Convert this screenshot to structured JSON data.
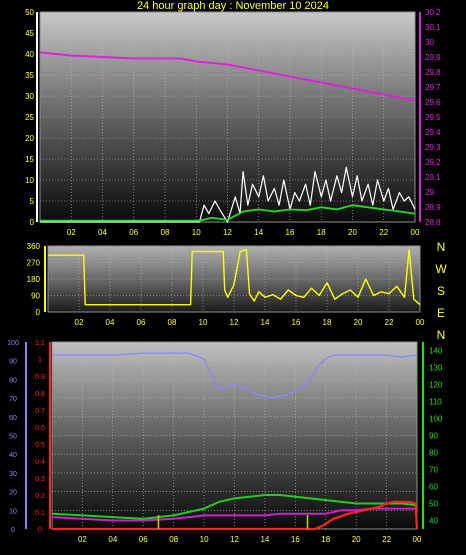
{
  "title": "24 hour graph day : November 10 2024",
  "colors": {
    "wind": "#ffffff",
    "gust": "#ffffff",
    "avg": "#22dd22",
    "pressure": "#dd22dd",
    "dir": "#ffff00",
    "humidity": "#8888ff",
    "temp": "#22cc22",
    "rain": "#ff2222",
    "dew": "#cc22cc",
    "solar": "#cccc00"
  },
  "compass": [
    "N",
    "W",
    "S",
    "E",
    "N"
  ],
  "chart_data": [
    {
      "type": "line",
      "name": "wind-pressure",
      "x_ticks": [
        "02",
        "04",
        "06",
        "08",
        "10",
        "12",
        "14",
        "16",
        "18",
        "20",
        "22",
        "00"
      ],
      "y_left_ticks": [
        "0",
        "5",
        "10",
        "15",
        "20",
        "25",
        "30",
        "35",
        "40",
        "45",
        "50"
      ],
      "y_left_lim": [
        0,
        50
      ],
      "y_right_ticks": [
        "28.8",
        "28.9",
        "29",
        "29.1",
        "29.2",
        "29.3",
        "29.4",
        "29.5",
        "29.6",
        "29.7",
        "29.8",
        "29.9",
        "30",
        "30.1",
        "30.2"
      ],
      "y_right_lim": [
        28.8,
        30.2
      ],
      "series": [
        {
          "axis": "right",
          "color": "pressure",
          "x": [
            0,
            2,
            4,
            6,
            8,
            9,
            10,
            11,
            12,
            13,
            14,
            15,
            16,
            17,
            18,
            19,
            20,
            21,
            22,
            23,
            24
          ],
          "y": [
            29.93,
            29.91,
            29.9,
            29.89,
            29.89,
            29.89,
            29.87,
            29.86,
            29.85,
            29.83,
            29.81,
            29.79,
            29.77,
            29.75,
            29.73,
            29.71,
            29.69,
            29.67,
            29.65,
            29.63,
            29.61
          ]
        },
        {
          "axis": "left",
          "color": "gust",
          "x": [
            0,
            10.2,
            10.5,
            10.8,
            11.2,
            11.5,
            12.0,
            12.5,
            12.8,
            13.0,
            13.3,
            13.6,
            14.0,
            14.3,
            14.6,
            15.0,
            15.3,
            15.6,
            16.0,
            16.3,
            16.6,
            17.0,
            17.3,
            17.6,
            18.0,
            18.3,
            18.6,
            19.0,
            19.3,
            19.6,
            20.0,
            20.3,
            20.6,
            21.0,
            21.3,
            21.6,
            22.0,
            22.3,
            22.6,
            23.0,
            23.3,
            23.6,
            24.0
          ],
          "y": [
            0,
            0,
            4,
            2,
            5,
            3,
            0,
            6,
            2,
            12,
            4,
            9,
            6,
            11,
            5,
            8,
            4,
            10,
            3,
            7,
            5,
            9,
            4,
            12,
            6,
            10,
            5,
            11,
            7,
            13,
            6,
            11,
            5,
            9,
            4,
            10,
            5,
            8,
            3,
            7,
            5,
            6,
            3
          ]
        },
        {
          "axis": "left",
          "color": "avg",
          "x": [
            0,
            10.2,
            11.0,
            12.0,
            12.5,
            13.0,
            14.0,
            15.0,
            16.0,
            17.0,
            18.0,
            19.0,
            20.0,
            21.0,
            22.0,
            23.0,
            24.0
          ],
          "y": [
            0.3,
            0.3,
            1,
            0.5,
            1.5,
            2.5,
            3,
            2.5,
            3,
            2.8,
            3.5,
            3,
            4,
            3.5,
            3,
            2.5,
            2
          ]
        }
      ]
    },
    {
      "type": "line",
      "name": "wind-direction",
      "x_ticks": [
        "02",
        "04",
        "06",
        "08",
        "10",
        "12",
        "14",
        "16",
        "18",
        "20",
        "22",
        "00"
      ],
      "y_ticks": [
        "0",
        "90",
        "180",
        "270",
        "360"
      ],
      "ylim": [
        0,
        360
      ],
      "series": [
        {
          "color": "dir",
          "x": [
            0,
            0.3,
            2.3,
            2.4,
            9.2,
            9.3,
            11.3,
            11.4,
            11.6,
            12.0,
            12.4,
            12.8,
            13.0,
            13.3,
            13.6,
            14.0,
            14.5,
            15.0,
            15.5,
            16.0,
            16.5,
            17.0,
            17.5,
            18.0,
            18.5,
            19.0,
            19.5,
            20.0,
            20.5,
            21.0,
            21.5,
            22.0,
            22.5,
            23.0,
            23.3,
            23.6,
            24.0
          ],
          "y": [
            310,
            310,
            310,
            40,
            40,
            330,
            330,
            120,
            80,
            150,
            330,
            340,
            100,
            60,
            110,
            80,
            95,
            70,
            120,
            90,
            80,
            130,
            90,
            160,
            70,
            100,
            120,
            80,
            180,
            90,
            110,
            100,
            140,
            80,
            340,
            70,
            40
          ]
        }
      ]
    },
    {
      "type": "line",
      "name": "humidity-temp-rain",
      "x_ticks": [
        "02",
        "04",
        "06",
        "08",
        "10",
        "12",
        "14",
        "16",
        "18",
        "20",
        "22",
        "00"
      ],
      "y_left_ticks": [
        "0",
        "10",
        "20",
        "30",
        "40",
        "50",
        "60",
        "70",
        "80",
        "90",
        "100"
      ],
      "y_left_lim": [
        0,
        100
      ],
      "y_left2_ticks": [
        "0",
        "0.1",
        "0.2",
        "0.3",
        "0.4",
        "0.5",
        "0.6",
        "0.7",
        "0.8",
        "0.9",
        "1",
        "1.1"
      ],
      "y_left2_lim": [
        0,
        1.1
      ],
      "y_right_ticks": [
        "40",
        "50",
        "60",
        "70",
        "80",
        "90",
        "100",
        "110",
        "120",
        "130",
        "140"
      ],
      "y_right_lim": [
        35,
        145
      ],
      "series": [
        {
          "axis": "left",
          "color": "humidity",
          "x": [
            0,
            2,
            4,
            6,
            8,
            9,
            10,
            10.5,
            11,
            11.5,
            12,
            12.5,
            13,
            13.5,
            14,
            14.5,
            15,
            15.5,
            16,
            16.5,
            17,
            17.5,
            18,
            18.5,
            19,
            20,
            21,
            22,
            23,
            24
          ],
          "y": [
            93,
            93,
            93,
            94,
            94,
            94,
            91,
            82,
            75,
            76,
            77,
            76,
            74,
            72,
            71,
            70,
            71,
            72,
            74,
            76,
            80,
            87,
            91,
            93,
            93,
            93,
            93,
            93,
            92,
            93
          ]
        },
        {
          "axis": "right",
          "color": "temp",
          "x": [
            0,
            2,
            4,
            6,
            7,
            8,
            9,
            10,
            11,
            12,
            13,
            14,
            15,
            16,
            17,
            18,
            19,
            20,
            21,
            22,
            23,
            24
          ],
          "y": [
            44,
            43,
            42,
            41,
            42,
            43,
            45,
            47,
            51,
            53,
            54,
            55,
            55,
            54,
            53,
            52,
            51,
            50,
            50,
            50,
            50,
            49
          ]
        },
        {
          "axis": "right",
          "color": "dew",
          "x": [
            0,
            2,
            4,
            6,
            8,
            9,
            10,
            11,
            12,
            13,
            14,
            15,
            16,
            17,
            18,
            19,
            20,
            21,
            22,
            23,
            24
          ],
          "y": [
            42,
            41,
            40,
            40,
            41,
            42,
            43,
            43,
            43,
            43,
            43,
            44,
            44,
            44,
            44,
            46,
            46,
            47,
            47,
            47,
            47
          ]
        },
        {
          "axis": "left2",
          "color": "rain",
          "x": [
            0,
            17.3,
            17.8,
            18.5,
            19.5,
            20.5,
            21.5,
            22,
            22.5,
            23,
            23.5,
            23.9,
            24
          ],
          "y": [
            0,
            0,
            0.02,
            0.06,
            0.09,
            0.11,
            0.13,
            0.15,
            0.16,
            0.16,
            0.16,
            0.15,
            0
          ]
        }
      ],
      "markers": [
        {
          "color": "solar",
          "x": 7.0
        },
        {
          "color": "solar",
          "x": 16.8
        }
      ]
    }
  ]
}
